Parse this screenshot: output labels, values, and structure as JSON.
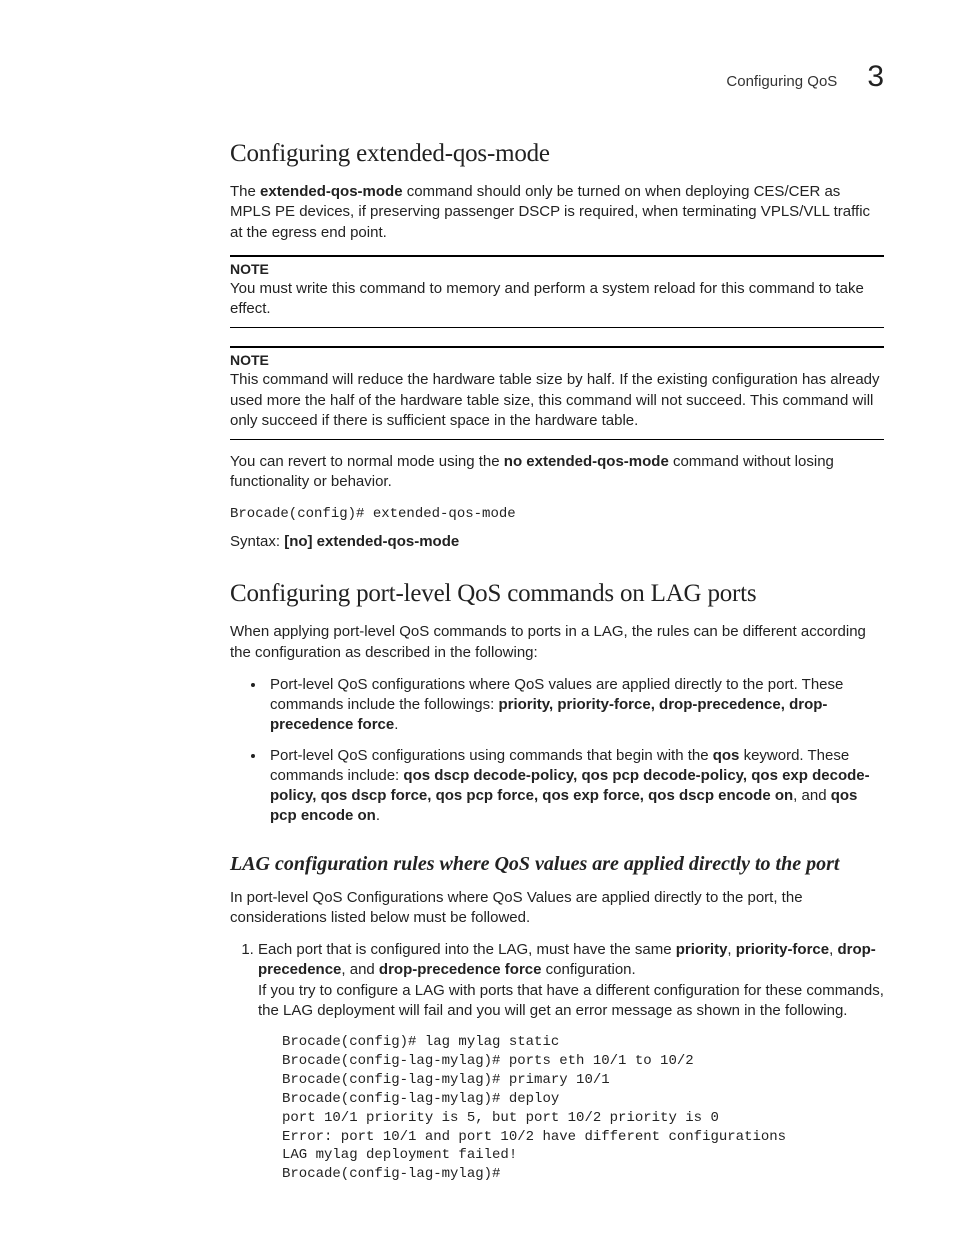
{
  "header": {
    "running_title": "Configuring QoS",
    "chapter_number": "3"
  },
  "section1": {
    "title": "Configuring extended-qos-mode",
    "intro_pre": "The ",
    "intro_bold": "extended-qos-mode",
    "intro_post": " command should only be turned on when deploying CES/CER as MPLS PE devices, if preserving passenger DSCP is required, when terminating VPLS/VLL traffic at the egress end point.",
    "note1": {
      "label": "NOTE",
      "text": "You must write this command to memory and perform a system reload for this command to take effect."
    },
    "note2": {
      "label": "NOTE",
      "text": "This command will reduce the hardware table size by half. If the existing configuration has already used more the half of the hardware table size, this command will not succeed. This command will only succeed if there is sufficient space in the hardware table."
    },
    "revert_pre": "You can revert to normal mode using the ",
    "revert_bold": "no extended-qos-mode",
    "revert_post": " command without losing functionality or behavior.",
    "code": "Brocade(config)# extended-qos-mode",
    "syntax_label": "Syntax:",
    "syntax_cmd": "  [no] extended-qos-mode"
  },
  "section2": {
    "title": "Configuring port-level QoS commands on LAG ports",
    "intro": "When applying port-level QoS commands to ports in a LAG, the rules can be different according the configuration as described in the following:",
    "bullet1": {
      "text_pre": "Port-level QoS configurations where QoS values are applied directly to the port. These commands include the followings: ",
      "bold_list": "priority, priority-force, drop-precedence, drop-precedence force",
      "text_post": "."
    },
    "bullet2": {
      "text_pre": "Port-level QoS configurations using commands that begin with the ",
      "kw": "qos",
      "text_mid": " keyword. These commands include:   ",
      "bold_list": "qos dscp decode-policy, qos pcp decode-policy, qos exp decode-policy, qos dscp force, qos pcp force, qos exp force, qos dscp encode on",
      "and": ", and ",
      "bold_last": "qos pcp encode on",
      "period": "."
    },
    "sub_title": "LAG configuration rules where QoS values are applied directly to the port",
    "sub_intro": "In port-level QoS Configurations where QoS Values are applied directly to the port, the considerations listed below must be followed.",
    "step1": {
      "pre": "Each port that is configured into the LAG, must have the same ",
      "b1": "priority",
      "c1": ", ",
      "b2": "priority-force",
      "c2": ", ",
      "b3": "drop-precedence",
      "c3": ", and ",
      "b4": "drop-precedence force",
      "post": " configuration."
    },
    "step1_sub": "If you try to configure a LAG with ports that have a different configuration for these commands, the LAG deployment will fail and you will get an error message as shown in the following.",
    "code_block": "Brocade(config)# lag mylag static\nBrocade(config-lag-mylag)# ports eth 10/1 to 10/2\nBrocade(config-lag-mylag)# primary 10/1\nBrocade(config-lag-mylag)# deploy\nport 10/1 priority is 5, but port 10/2 priority is 0\nError: port 10/1 and port 10/2 have different configurations\nLAG mylag deployment failed!\nBrocade(config-lag-mylag)#"
  }
}
